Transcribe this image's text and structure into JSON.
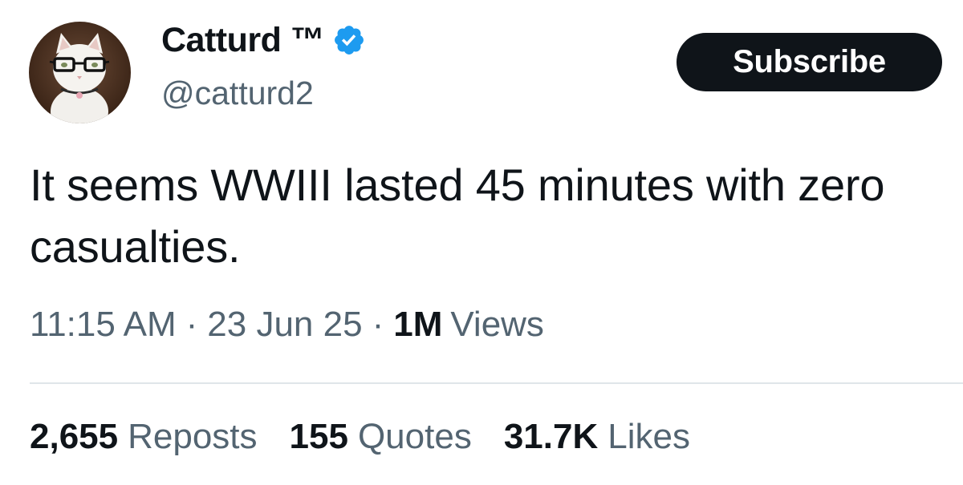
{
  "author": {
    "display_name": "Catturd ™",
    "handle": "@catturd2",
    "verified": true,
    "verified_color": "#1d9bf0"
  },
  "actions": {
    "subscribe_label": "Subscribe"
  },
  "post": {
    "text": "It seems WWIII lasted 45 minutes with zero casualties.",
    "time": "11:15 AM",
    "date": "23 Jun 25",
    "separator": "·",
    "views_count": "1M",
    "views_label": "Views"
  },
  "stats": {
    "reposts": {
      "count": "2,655",
      "label": "Reposts"
    },
    "quotes": {
      "count": "155",
      "label": "Quotes"
    },
    "likes": {
      "count": "31.7K",
      "label": "Likes"
    }
  },
  "colors": {
    "text_primary": "#0f1419",
    "text_secondary": "#536471",
    "button_bg": "#0f1419",
    "divider": "#dfe5e9"
  }
}
